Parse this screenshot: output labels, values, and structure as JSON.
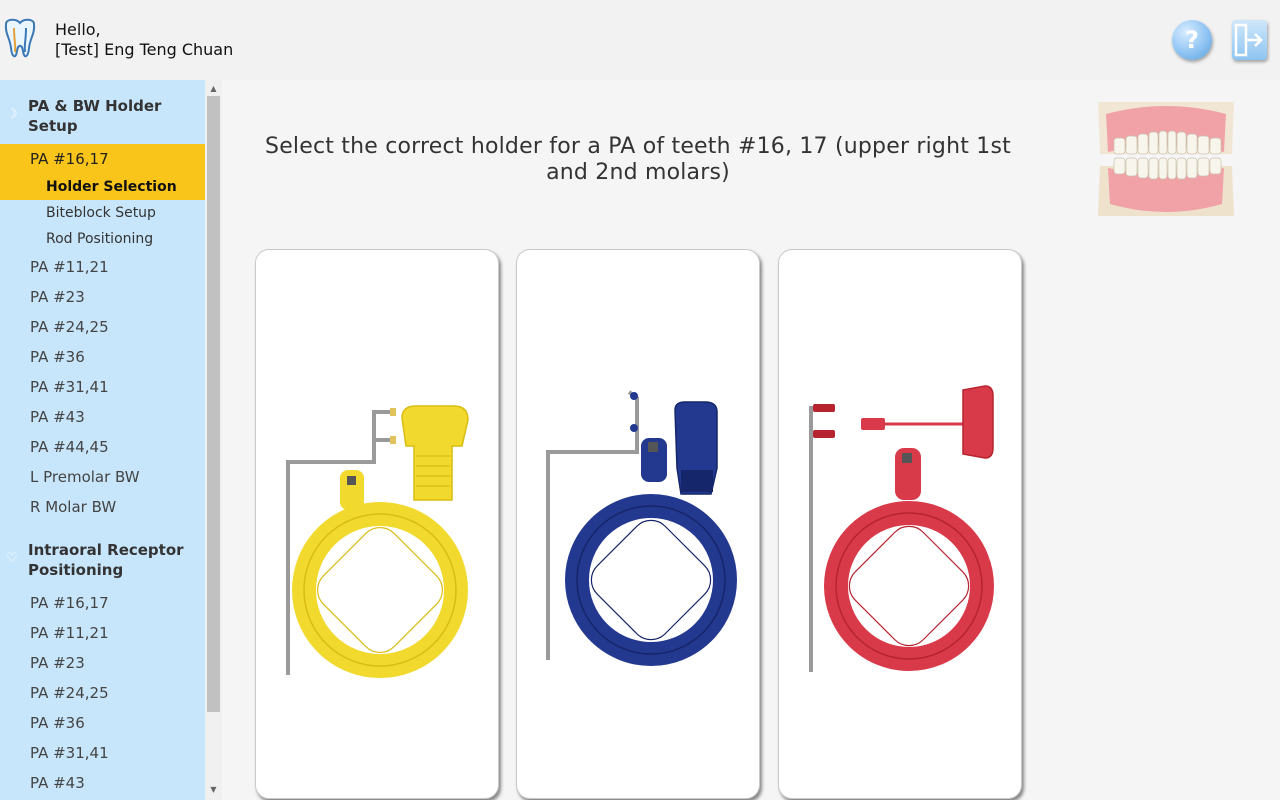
{
  "header": {
    "greeting_line1": "Hello,",
    "greeting_line2": "[Test] Eng Teng Chuan",
    "help_label": "?",
    "icons": {
      "logo": "tooth-logo-icon",
      "help": "help-icon",
      "logout": "logout-icon"
    }
  },
  "sidebar": {
    "sections": [
      {
        "title": "PA & BW Holder Setup",
        "icon": "holder-icon",
        "items": [
          {
            "label": "PA #16,17",
            "active": true,
            "subitems": [
              {
                "label": "Holder Selection",
                "active": true
              },
              {
                "label": "Biteblock Setup",
                "active": false
              },
              {
                "label": "Rod Positioning",
                "active": false
              }
            ]
          },
          {
            "label": "PA #11,21"
          },
          {
            "label": "PA #23"
          },
          {
            "label": "PA #24,25"
          },
          {
            "label": "PA #36"
          },
          {
            "label": "PA #31,41"
          },
          {
            "label": "PA #43"
          },
          {
            "label": "PA #44,45"
          },
          {
            "label": "L Premolar BW"
          },
          {
            "label": "R Molar BW"
          }
        ]
      },
      {
        "title": "Intraoral Receptor Positioning",
        "icon": "receptor-icon",
        "items": [
          {
            "label": "PA #16,17"
          },
          {
            "label": "PA #11,21"
          },
          {
            "label": "PA #23"
          },
          {
            "label": "PA #24,25"
          },
          {
            "label": "PA #36"
          },
          {
            "label": "PA #31,41"
          },
          {
            "label": "PA #43"
          }
        ]
      }
    ]
  },
  "main": {
    "prompt": "Select the correct holder for a PA of teeth #16, 17 (upper right 1st and 2nd molars)",
    "reference_image": "dental-model-icon",
    "options": [
      {
        "name": "yellow-holder-option",
        "color": "#f2d92e",
        "dark": "#d9bd10"
      },
      {
        "name": "blue-holder-option",
        "color": "#23388f",
        "dark": "#15266a"
      },
      {
        "name": "red-holder-option",
        "color": "#d93a4a",
        "dark": "#b5242f"
      }
    ]
  }
}
